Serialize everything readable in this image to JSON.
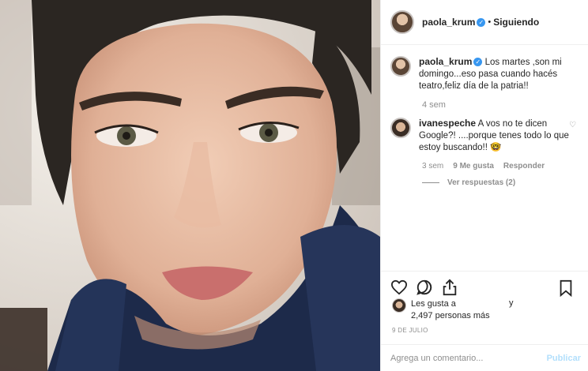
{
  "header": {
    "username": "paola_krum",
    "dot": "•",
    "follow_status": "Siguiendo"
  },
  "caption": {
    "username": "paola_krum",
    "text": "Los martes ,son mi domingo...eso pasa cuando hacés teatro,feliz día de la patria!!",
    "time": "4 sem"
  },
  "comment": {
    "username": "ivanespeche",
    "text": "A vos no te dicen Google?! ....porque tenes todo lo que estoy buscando!! 🤓",
    "time": "3 sem",
    "likes": "9 Me gusta",
    "reply_label": "Responder",
    "view_replies": "Ver respuestas (2)"
  },
  "likes": {
    "line1": "Les gusta a",
    "connector": "y",
    "line2": "2,497 personas más"
  },
  "date": "9 DE JULIO",
  "add_comment": {
    "placeholder": "Agrega un comentario...",
    "publish_label": "Publicar"
  },
  "colors": {
    "verified_blue": "#3897f0",
    "muted_text": "#8e8e8e",
    "publish_disabled": "#b2dffc"
  },
  "icons": [
    "verified-icon",
    "heart-icon",
    "comment-icon",
    "share-icon",
    "bookmark-icon"
  ]
}
